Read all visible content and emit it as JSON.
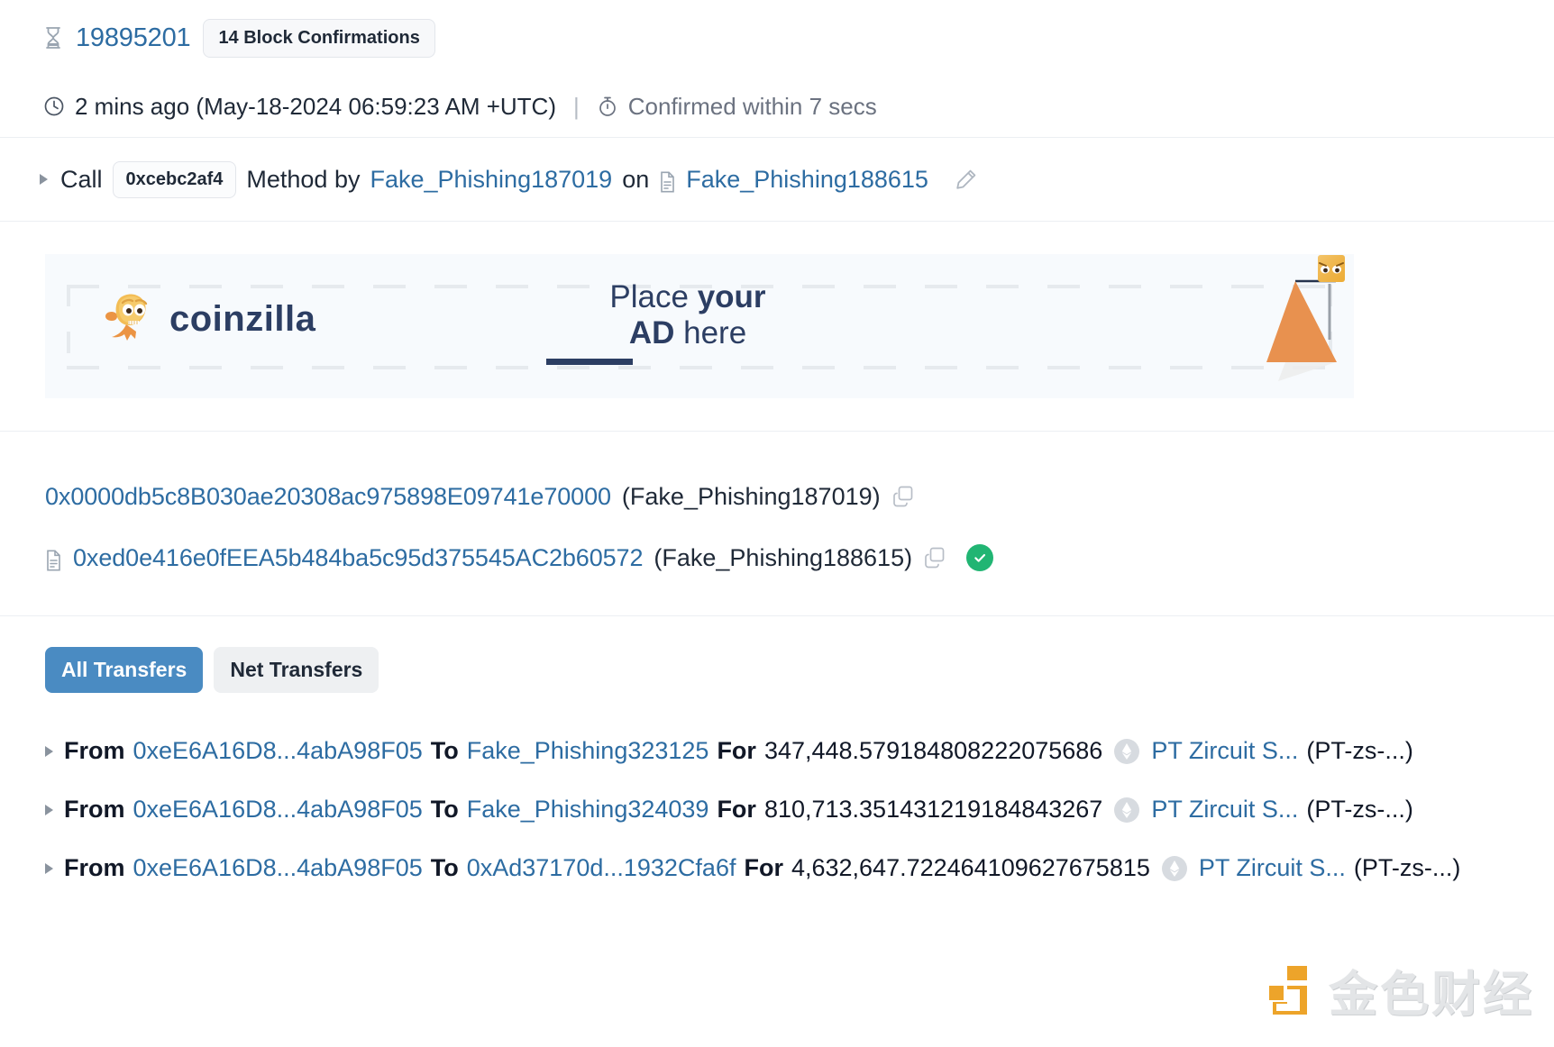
{
  "block": {
    "icon": "hourglass-icon",
    "number": "19895201",
    "confirmations": "14 Block Confirmations"
  },
  "timestamp": {
    "clock_icon": "clock-icon",
    "age": "2 mins ago (May-18-2024 06:59:23 AM +UTC)",
    "separator": "|",
    "stopwatch_icon": "stopwatch-icon",
    "confirmed": "Confirmed within 7 secs"
  },
  "call": {
    "caret_icon": "chevron-right-icon",
    "prefix": "Call",
    "method_id": "0xcebc2af4",
    "middle": "Method by",
    "from_label": "Fake_Phishing187019",
    "on": "on",
    "contract_icon": "document-icon",
    "contract_label": "Fake_Phishing188615",
    "edit_icon": "pencil-icon"
  },
  "ad": {
    "logo_text": "coinzilla",
    "mascot_icon": "coinzilla-dino-icon",
    "headline_line1_plain": "Place ",
    "headline_line1_bold": "your",
    "headline_line2_bold": "AD",
    "headline_line2_plain": " here",
    "art_icon": "orange-flag-icon"
  },
  "addresses": [
    {
      "hash": "0x0000db5c8B030ae20308ac975898E09741e70000",
      "tag": "(Fake_Phishing187019)",
      "has_doc_icon": false,
      "copy_icon": "copy-icon",
      "verified": false
    },
    {
      "hash": "0xed0e416e0fEEA5b484ba5c95d375545AC2b60572",
      "tag": "(Fake_Phishing188615)",
      "has_doc_icon": true,
      "copy_icon": "copy-icon",
      "verified": true,
      "verified_icon": "check-circle-icon"
    }
  ],
  "transfers": {
    "tabs": [
      {
        "label": "All Transfers",
        "active": true
      },
      {
        "label": "Net Transfers",
        "active": false
      }
    ],
    "rows": [
      {
        "caret_icon": "chevron-right-icon",
        "from_label": "From",
        "from": "0xeE6A16D8...4abA98F05",
        "to_label": "To",
        "to": "Fake_Phishing323125",
        "for_label": "For",
        "amount": "347,448.579184808222075686",
        "token_icon": "ethereum-token-icon",
        "token_name": "PT Zircuit S...",
        "token_symbol": "(PT-zs-...)"
      },
      {
        "caret_icon": "chevron-right-icon",
        "from_label": "From",
        "from": "0xeE6A16D8...4abA98F05",
        "to_label": "To",
        "to": "Fake_Phishing324039",
        "for_label": "For",
        "amount": "810,713.351431219184843267",
        "token_icon": "ethereum-token-icon",
        "token_name": "PT Zircuit S...",
        "token_symbol": "(PT-zs-...)"
      },
      {
        "caret_icon": "chevron-right-icon",
        "from_label": "From",
        "from": "0xeE6A16D8...4abA98F05",
        "to_label": "To",
        "to": "0xAd37170d...1932Cfa6f",
        "for_label": "For",
        "amount": "4,632,647.722464109627675815",
        "token_icon": "ethereum-token-icon",
        "token_name": "PT Zircuit S...",
        "token_symbol": "(PT-zs-...)"
      }
    ]
  },
  "watermark": {
    "logo_icon": "jinse-logo-icon",
    "text": "金色财经"
  },
  "colors": {
    "link": "#2d6ca2",
    "tab_active_bg": "#4a8bc2",
    "verified_green": "#21b573",
    "ad_navy": "#2c3e63",
    "ad_orange": "#e8914f"
  }
}
